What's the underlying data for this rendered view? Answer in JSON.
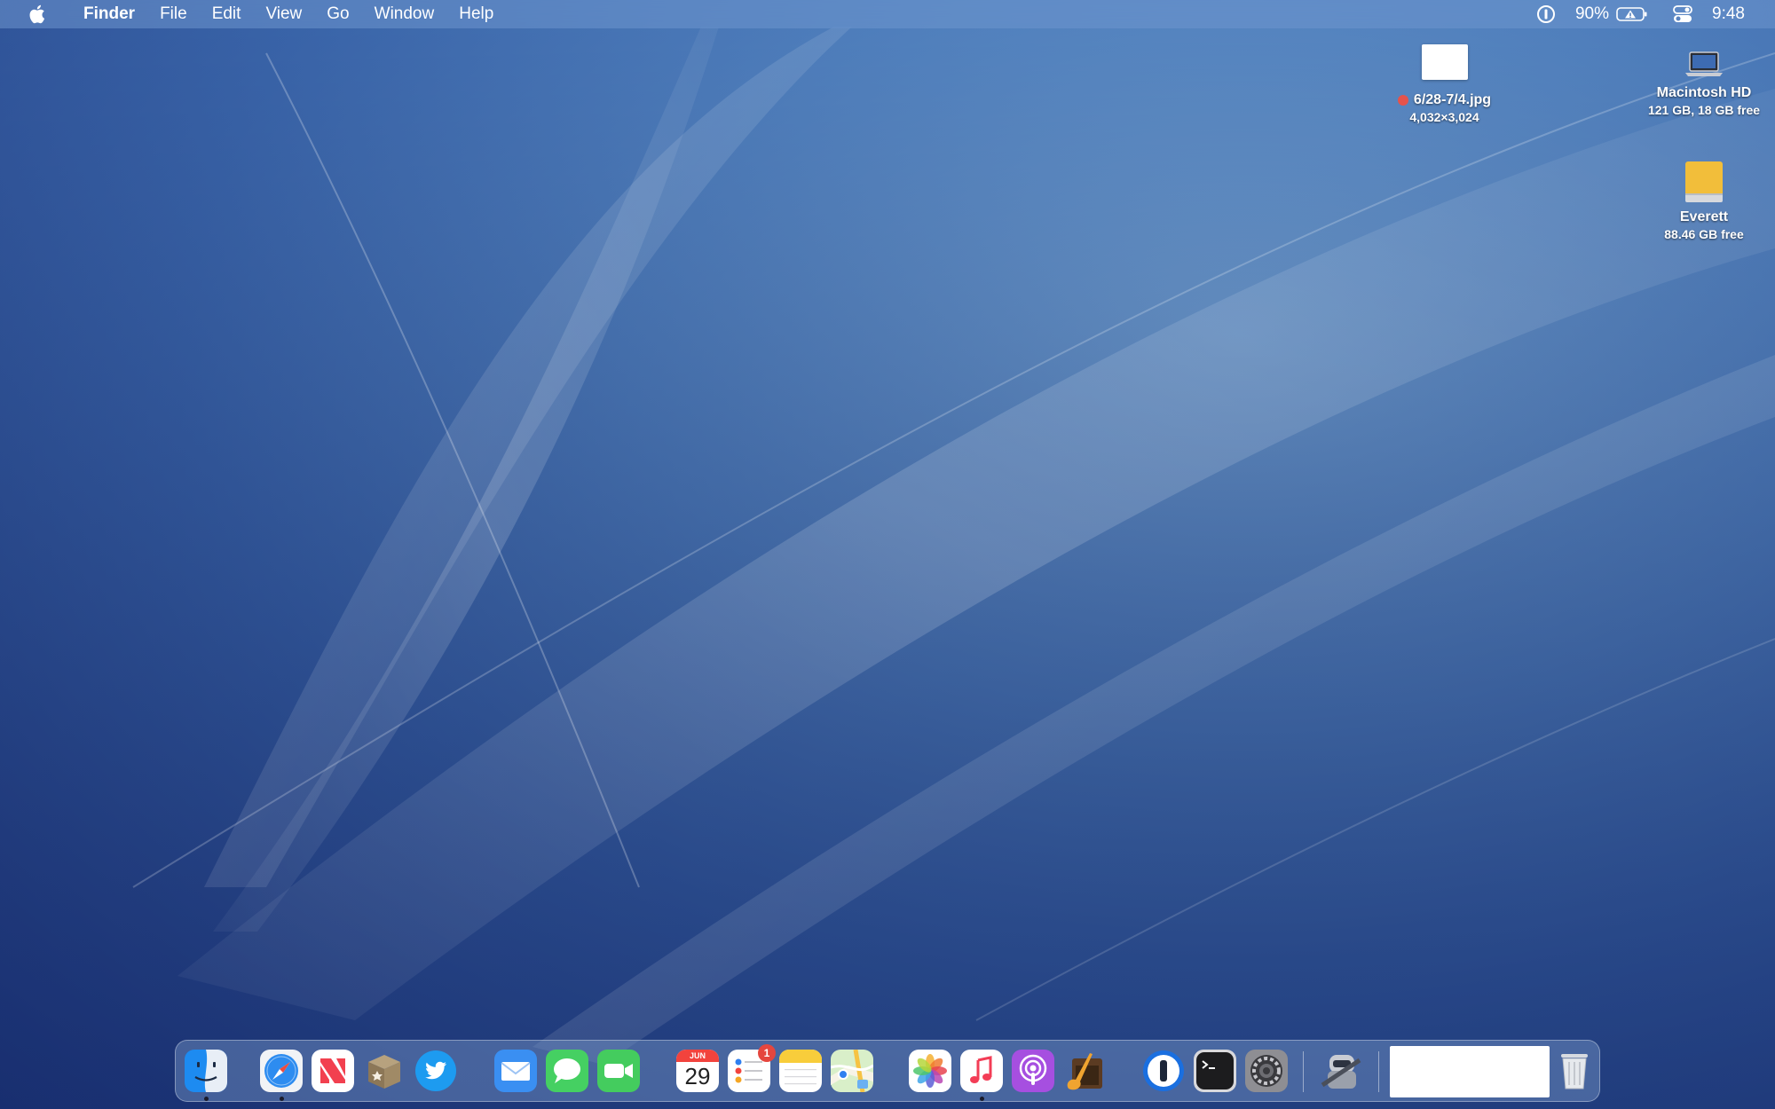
{
  "menubar": {
    "app_name": "Finder",
    "menus": [
      "File",
      "Edit",
      "View",
      "Go",
      "Window",
      "Help"
    ],
    "battery_percent": "90%",
    "clock": "9:48"
  },
  "desktop": {
    "file": {
      "name": "6/28-7/4.jpg",
      "dimensions": "4,032×3,024",
      "tag_color": "#e5534b"
    },
    "macintosh_hd": {
      "name": "Macintosh HD",
      "info": "121 GB, 18 GB free"
    },
    "everett": {
      "name": "Everett",
      "info": "88.46 GB free"
    }
  },
  "dock": {
    "calendar": {
      "month": "JUN",
      "day": "29"
    },
    "reminders_badge": "1",
    "apps": [
      "finder",
      "safari",
      "news",
      "archive-utility",
      "twitter",
      "mail",
      "messages",
      "facetime",
      "calendar",
      "reminders",
      "notes",
      "maps",
      "photos",
      "music",
      "podcasts",
      "garageband",
      "1password",
      "terminal",
      "system-preferences",
      "automator",
      "downloads-stack",
      "trash"
    ]
  },
  "colors": {
    "accent": "#3b6fb6",
    "badge": "#e5463e"
  }
}
